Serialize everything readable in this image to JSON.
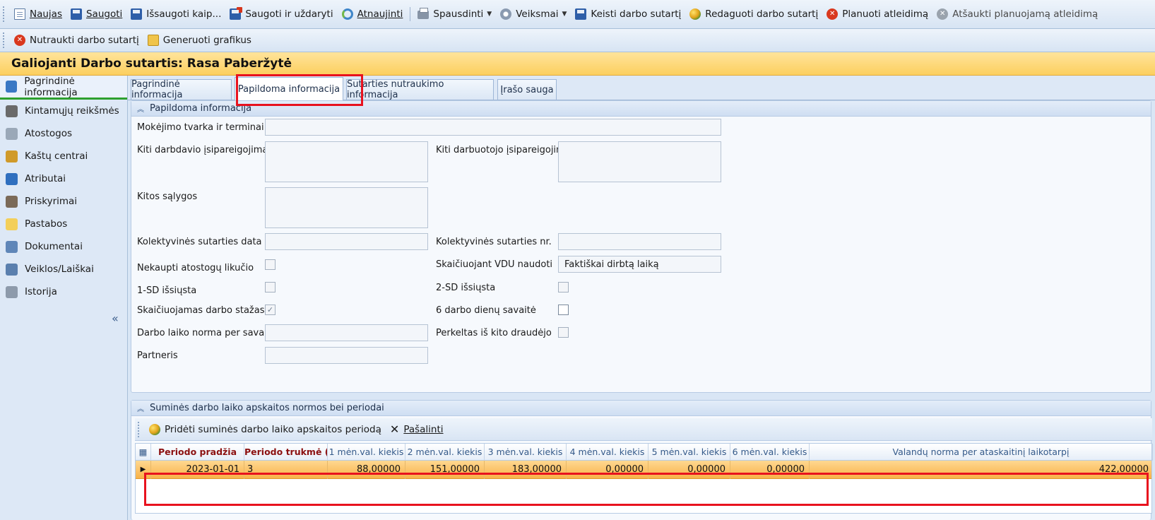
{
  "toolbar1": {
    "new": "Naujas",
    "save": "Saugoti",
    "save_as": "Išsaugoti kaip...",
    "save_close": "Saugoti ir uždaryti",
    "refresh": "Atnaujinti",
    "print": "Spausdinti",
    "actions": "Veiksmai",
    "change_contract": "Keisti darbo sutartį",
    "edit_contract": "Redaguoti darbo sutartį",
    "plan_dismissal": "Planuoti atleidimą",
    "cancel_dismissal": "Atšaukti planuojamą atleidimą"
  },
  "toolbar2": {
    "terminate": "Nutraukti darbo sutartį",
    "generate": "Generuoti grafikus"
  },
  "title": "Galiojanti Darbo sutartis: Rasa Paberžytė",
  "sidebar": {
    "items": [
      {
        "label": "Pagrindinė informacija",
        "color": "#3a78c4"
      },
      {
        "label": "Kintamųjų reikšmės",
        "color": "#6a6a6a"
      },
      {
        "label": "Atostogos",
        "color": "#9aa8b8"
      },
      {
        "label": "Kaštų centrai",
        "color": "#d09a2a"
      },
      {
        "label": "Atributai",
        "color": "#2f6fbf"
      },
      {
        "label": "Priskyrimai",
        "color": "#7b6a58"
      },
      {
        "label": "Pastabos",
        "color": "#f3cf5a"
      },
      {
        "label": "Dokumentai",
        "color": "#5f86b8"
      },
      {
        "label": "Veiklos/Laiškai",
        "color": "#5a7fae"
      },
      {
        "label": "Istorija",
        "color": "#8d9aab"
      }
    ],
    "collapse": "«"
  },
  "tabs": [
    "Pagrindinė informacija",
    "Papildoma informacija",
    "Sutarties nutraukimo informacija",
    "Įrašo sauga"
  ],
  "group1": {
    "title": "Papildoma informacija",
    "fields": {
      "payment_order": "Mokėjimo tvarka ir terminai",
      "employer_obligations": "Kiti darbdavio įsipareigojimai",
      "employee_obligations": "Kiti darbuotojo įsipareigojimai",
      "other_conditions": "Kitos sąlygos",
      "collective_date": "Kolektyvinės sutarties data",
      "collective_nr": "Kolektyvinės sutarties nr.",
      "no_leave_balance": "Nekaupti atostogų likučio",
      "vdu_use": "Skaičiuojant VDU naudoti",
      "vdu_value": "Faktiškai dirbtą laiką",
      "sd1_sent": "1-SD išsiųsta",
      "sd2_sent": "2-SD išsiųsta",
      "seniority": "Skaičiuojamas darbo stažas",
      "six_day_week": "6 darbo dienų savaitė",
      "weekly_norm": "Darbo laiko norma per savaitę",
      "transferred": "Perkeltas iš kito draudėjo",
      "partner": "Partneris"
    },
    "checks": {
      "no_leave_balance": false,
      "sd1_sent": false,
      "sd2_sent": false,
      "seniority": true,
      "six_day_week": false,
      "transferred": false
    }
  },
  "group2": {
    "title": "Suminės darbo laiko apskaitos normos bei periodai",
    "add_label": "Pridėti suminės darbo laiko apskaitos periodą",
    "remove_label": "Pašalinti",
    "columns": [
      "Periodo pradžia",
      "Periodo trukmė (",
      "1 mėn.val. kiekis",
      "2 mėn.val. kiekis",
      "3 mėn.val. kiekis",
      "4 mėn.val. kiekis",
      "5 mėn.val. kiekis",
      "6 mėn.val. kiekis",
      "Valandų norma per ataskaitinį laikotarpį"
    ],
    "rows": [
      [
        "2023-01-01",
        "3",
        "88,00000",
        "151,00000",
        "183,00000",
        "0,00000",
        "0,00000",
        "0,00000",
        "422,00000"
      ]
    ]
  }
}
